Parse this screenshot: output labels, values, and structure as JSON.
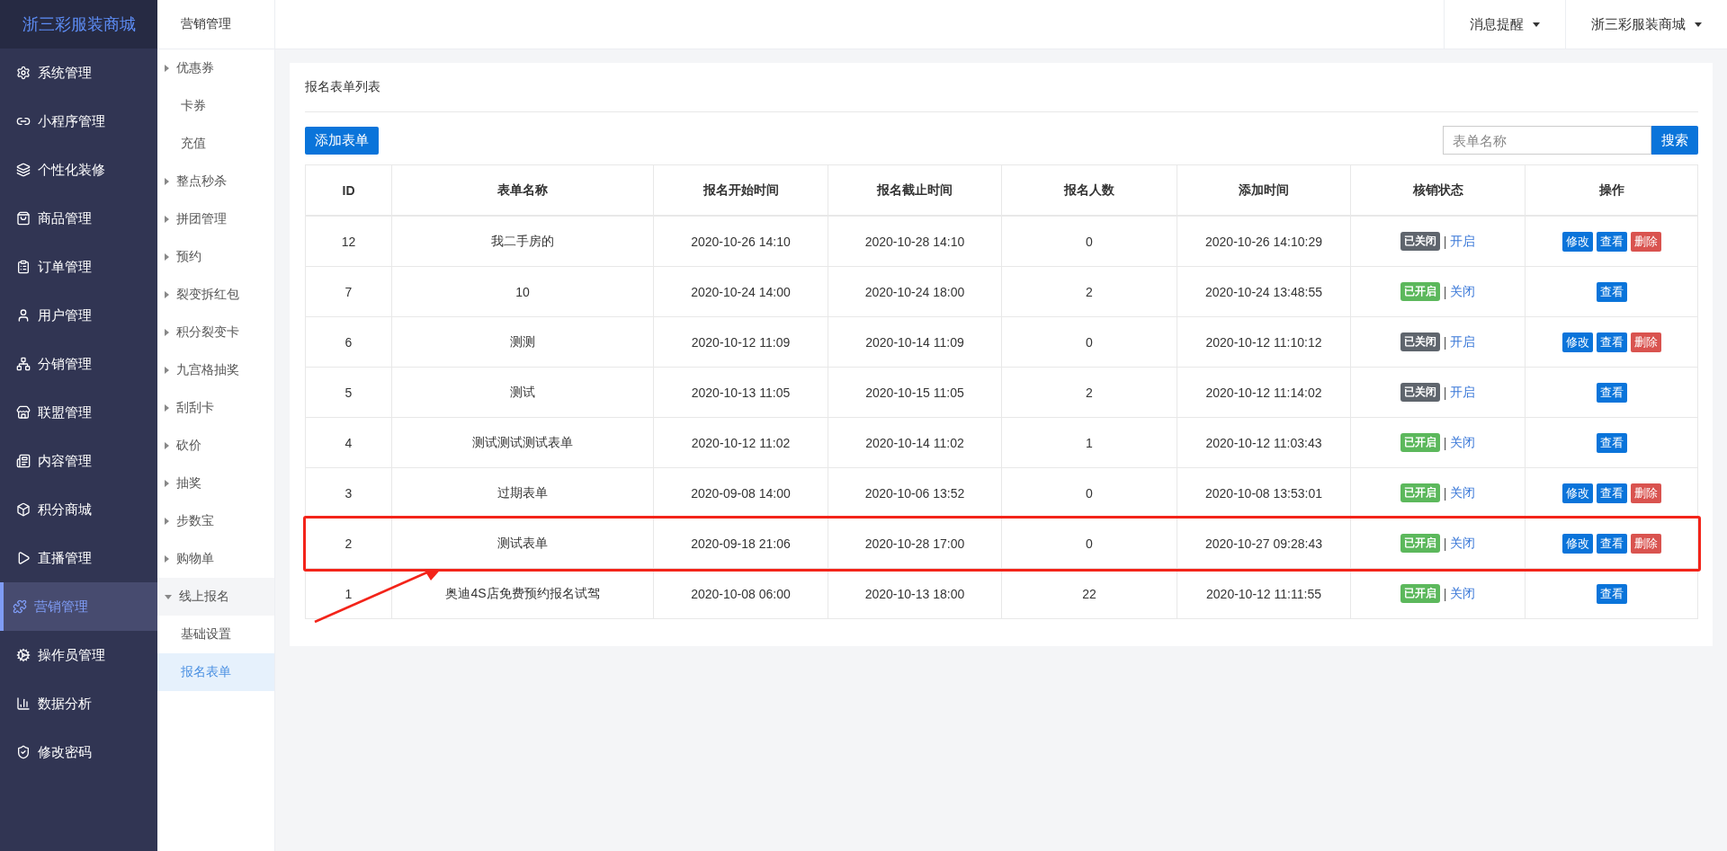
{
  "brand": "浙三彩服装商城",
  "sidebar": {
    "items": [
      {
        "label": "系统管理",
        "selected": false
      },
      {
        "label": "小程序管理",
        "selected": false
      },
      {
        "label": "个性化装修",
        "selected": false
      },
      {
        "label": "商品管理",
        "selected": false
      },
      {
        "label": "订单管理",
        "selected": false
      },
      {
        "label": "用户管理",
        "selected": false
      },
      {
        "label": "分销管理",
        "selected": false
      },
      {
        "label": "联盟管理",
        "selected": false
      },
      {
        "label": "内容管理",
        "selected": false
      },
      {
        "label": "积分商城",
        "selected": false
      },
      {
        "label": "直播管理",
        "selected": false
      },
      {
        "label": "营销管理",
        "selected": true
      },
      {
        "label": "操作员管理",
        "selected": false
      },
      {
        "label": "数据分析",
        "selected": false
      },
      {
        "label": "修改密码",
        "selected": false
      }
    ]
  },
  "submenu": {
    "title": "营销管理",
    "items": [
      {
        "label": "优惠券",
        "expanded": false
      },
      {
        "label": "卡券",
        "selected": false
      },
      {
        "label": "充值",
        "selected": false
      },
      {
        "label": "整点秒杀",
        "expanded": false
      },
      {
        "label": "拼团管理",
        "expanded": false
      },
      {
        "label": "预约",
        "expanded": false
      },
      {
        "label": "裂变拆红包",
        "expanded": false
      },
      {
        "label": "积分裂变卡",
        "expanded": false
      },
      {
        "label": "九宫格抽奖",
        "expanded": false
      },
      {
        "label": "刮刮卡",
        "expanded": false
      },
      {
        "label": "砍价",
        "expanded": false
      },
      {
        "label": "抽奖",
        "expanded": false
      },
      {
        "label": "步数宝",
        "expanded": false
      },
      {
        "label": "购物单",
        "expanded": false
      },
      {
        "label": "线上报名",
        "expanded": true,
        "children": [
          {
            "label": "基础设置",
            "selected": false
          },
          {
            "label": "报名表单",
            "selected": true
          }
        ]
      }
    ]
  },
  "topbar": {
    "menus": [
      "消息提醒",
      "浙三彩服装商城"
    ]
  },
  "panel": {
    "title": "报名表单列表",
    "add_button": "添加表单",
    "search": {
      "placeholder": "表单名称",
      "button": "搜索"
    }
  },
  "table": {
    "columns": [
      "ID",
      "表单名称",
      "报名开始时间",
      "报名截止时间",
      "报名人数",
      "添加时间",
      "核销状态",
      "操作"
    ],
    "rows": [
      {
        "id": "12",
        "name": "我二手房的",
        "start": "2020-10-26 14:10",
        "end": "2020-10-28 14:10",
        "count": "0",
        "added": "2020-10-26 14:10:29",
        "status": {
          "kind": "closed",
          "tag": "已关闭",
          "separator": "|",
          "link": "开启"
        },
        "actions": [
          {
            "kind": "edit",
            "label": "修改"
          },
          {
            "kind": "view",
            "label": "查看"
          },
          {
            "kind": "delete",
            "label": "删除"
          }
        ],
        "highlighted": false
      },
      {
        "id": "7",
        "name": "10",
        "start": "2020-10-24 14:00",
        "end": "2020-10-24 18:00",
        "count": "2",
        "added": "2020-10-24 13:48:55",
        "status": {
          "kind": "open",
          "tag": "已开启",
          "separator": "|",
          "link": "关闭"
        },
        "actions": [
          {
            "kind": "view",
            "label": "查看"
          }
        ],
        "highlighted": false
      },
      {
        "id": "6",
        "name": "测测",
        "start": "2020-10-12 11:09",
        "end": "2020-10-14 11:09",
        "count": "0",
        "added": "2020-10-12 11:10:12",
        "status": {
          "kind": "closed",
          "tag": "已关闭",
          "separator": "|",
          "link": "开启"
        },
        "actions": [
          {
            "kind": "edit",
            "label": "修改"
          },
          {
            "kind": "view",
            "label": "查看"
          },
          {
            "kind": "delete",
            "label": "删除"
          }
        ],
        "highlighted": false
      },
      {
        "id": "5",
        "name": "测试",
        "start": "2020-10-13 11:05",
        "end": "2020-10-15 11:05",
        "count": "2",
        "added": "2020-10-12 11:14:02",
        "status": {
          "kind": "closed",
          "tag": "已关闭",
          "separator": "|",
          "link": "开启"
        },
        "actions": [
          {
            "kind": "view",
            "label": "查看"
          }
        ],
        "highlighted": false
      },
      {
        "id": "4",
        "name": "测试测试测试表单",
        "start": "2020-10-12 11:02",
        "end": "2020-10-14 11:02",
        "count": "1",
        "added": "2020-10-12 11:03:43",
        "status": {
          "kind": "open",
          "tag": "已开启",
          "separator": "|",
          "link": "关闭"
        },
        "actions": [
          {
            "kind": "view",
            "label": "查看"
          }
        ],
        "highlighted": false
      },
      {
        "id": "3",
        "name": "过期表单",
        "start": "2020-09-08 14:00",
        "end": "2020-10-06 13:52",
        "count": "0",
        "added": "2020-10-08 13:53:01",
        "status": {
          "kind": "open",
          "tag": "已开启",
          "separator": "|",
          "link": "关闭"
        },
        "actions": [
          {
            "kind": "edit",
            "label": "修改"
          },
          {
            "kind": "view",
            "label": "查看"
          },
          {
            "kind": "delete",
            "label": "删除"
          }
        ],
        "highlighted": false
      },
      {
        "id": "2",
        "name": "测试表单",
        "start": "2020-09-18 21:06",
        "end": "2020-10-28 17:00",
        "count": "0",
        "added": "2020-10-27 09:28:43",
        "status": {
          "kind": "open",
          "tag": "已开启",
          "separator": "|",
          "link": "关闭"
        },
        "actions": [
          {
            "kind": "edit",
            "label": "修改"
          },
          {
            "kind": "view",
            "label": "查看"
          },
          {
            "kind": "delete",
            "label": "删除"
          }
        ],
        "highlighted": true
      },
      {
        "id": "1",
        "name": "奥迪4S店免费预约报名试驾",
        "start": "2020-10-08 06:00",
        "end": "2020-10-13 18:00",
        "count": "22",
        "added": "2020-10-12 11:11:55",
        "status": {
          "kind": "open",
          "tag": "已开启",
          "separator": "|",
          "link": "关闭"
        },
        "actions": [
          {
            "kind": "view",
            "label": "查看"
          }
        ],
        "highlighted": false
      }
    ]
  }
}
